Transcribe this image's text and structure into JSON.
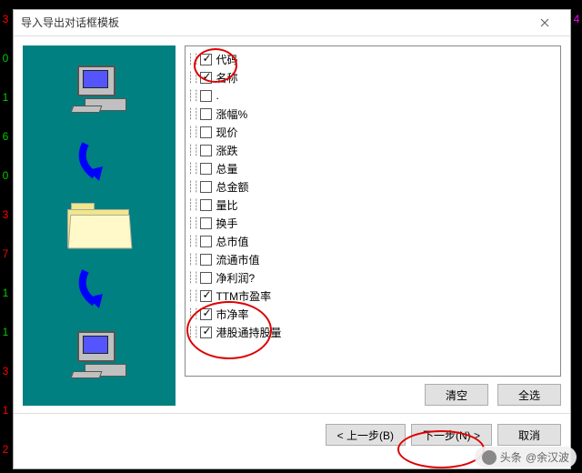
{
  "title": "导入导出对话框模板",
  "items": [
    {
      "label": "代码",
      "checked": true
    },
    {
      "label": "名称",
      "checked": true
    },
    {
      "label": ".",
      "checked": false
    },
    {
      "label": "涨幅%",
      "checked": false
    },
    {
      "label": "现价",
      "checked": false
    },
    {
      "label": "涨跌",
      "checked": false
    },
    {
      "label": "总量",
      "checked": false
    },
    {
      "label": "总金额",
      "checked": false
    },
    {
      "label": "量比",
      "checked": false
    },
    {
      "label": "换手",
      "checked": false
    },
    {
      "label": "总市值",
      "checked": false
    },
    {
      "label": "流通市值",
      "checked": false
    },
    {
      "label": "净利润?",
      "checked": false
    },
    {
      "label": "TTM市盈率",
      "checked": true
    },
    {
      "label": "市净率",
      "checked": true
    },
    {
      "label": "港股通持股量",
      "checked": true
    }
  ],
  "buttons": {
    "clear": "清空",
    "all": "全选",
    "prev": "< 上一步(B)",
    "next": "下一步(N) >",
    "cancel": "取消"
  },
  "watermark": {
    "prefix": "头条",
    "at": "@余汉波"
  }
}
